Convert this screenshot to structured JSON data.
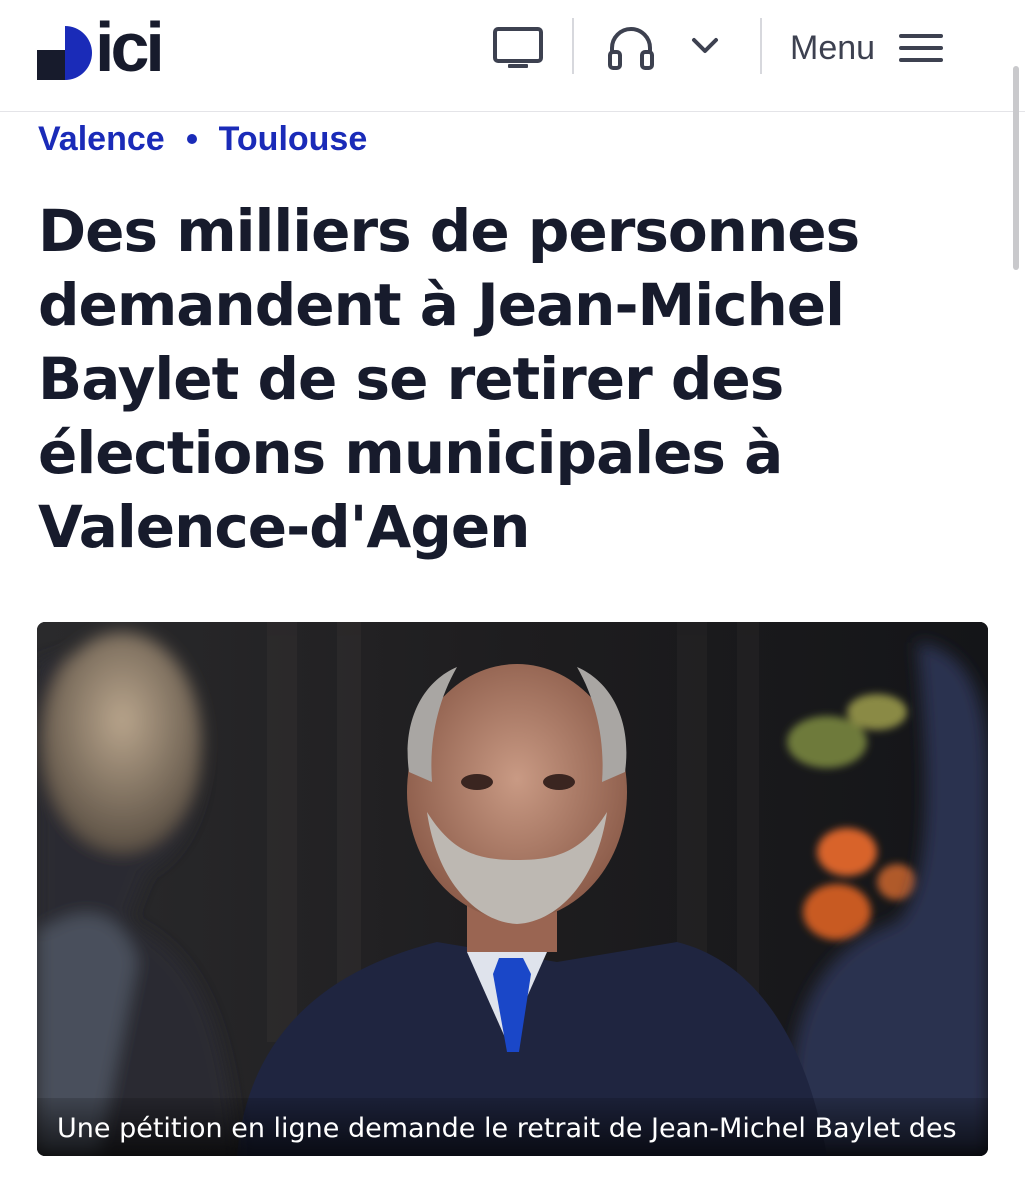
{
  "header": {
    "logo_text": "ici",
    "menu_label": "Menu",
    "accent_color": "#1a2bb8",
    "icons": [
      "tv-icon",
      "headphones-icon",
      "chevron-down-icon",
      "hamburger-icon"
    ]
  },
  "breadcrumb": {
    "items": [
      "Valence",
      "Toulouse"
    ]
  },
  "article": {
    "title": "Des milliers de personnes demandent à Jean-Michel Baylet de se retirer des élections municipales à Valence-d'Agen",
    "image_caption": "Une pétition en ligne demande le retrait de Jean-Michel Baylet des ..."
  }
}
